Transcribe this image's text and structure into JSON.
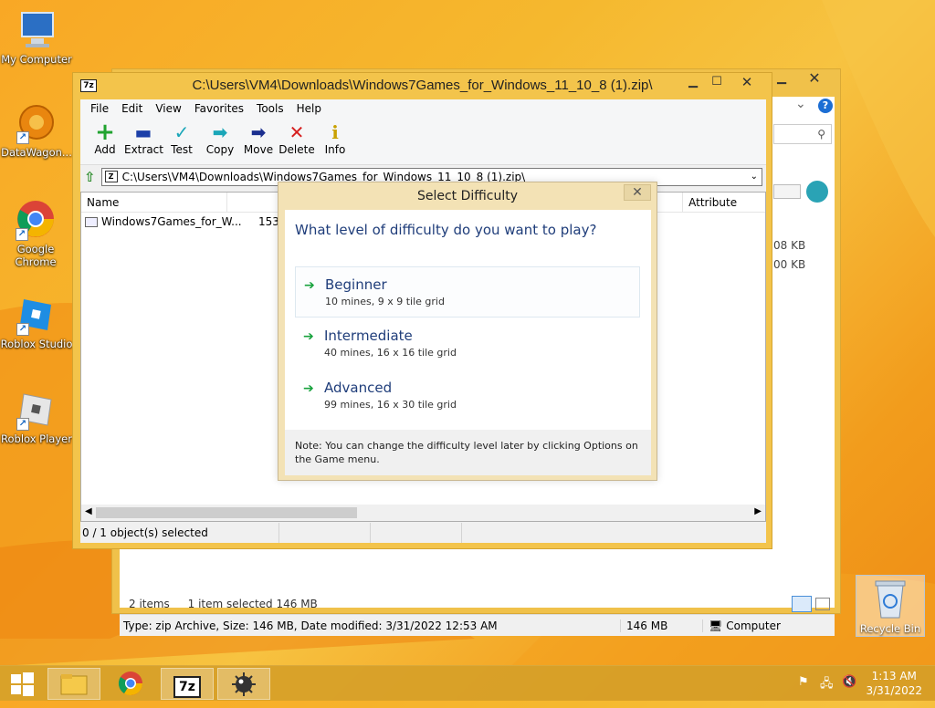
{
  "desktop": {
    "icons": [
      {
        "label": "My Computer"
      },
      {
        "label": "DataWagon..."
      },
      {
        "label": "Google Chrome"
      },
      {
        "label": "Roblox Studio"
      },
      {
        "label": "Roblox Player"
      }
    ],
    "recycle_bin_label": "Recycle Bin"
  },
  "back_window": {
    "size1": "08 KB",
    "size2": "00 KB",
    "items_count": "2 items",
    "selected_info": "1 item selected  146 MB",
    "status_type": "Type: zip Archive, Size: 146 MB, Date modified: 3/31/2022 12:53 AM",
    "status_size": "146 MB",
    "status_location": "Computer"
  },
  "sevenzip": {
    "app_icon_text": "7z",
    "title": "C:\\Users\\VM4\\Downloads\\Windows7Games_for_Windows_11_10_8 (1).zip\\",
    "menu": [
      "File",
      "Edit",
      "View",
      "Favorites",
      "Tools",
      "Help"
    ],
    "toolbar": [
      {
        "label": "Add",
        "icon": "+"
      },
      {
        "label": "Extract",
        "icon": "▬"
      },
      {
        "label": "Test",
        "icon": "✓"
      },
      {
        "label": "Copy",
        "icon": "➡"
      },
      {
        "label": "Move",
        "icon": "➡"
      },
      {
        "label": "Delete",
        "icon": "✕"
      },
      {
        "label": "Info",
        "icon": "i"
      }
    ],
    "address": "C:\\Users\\VM4\\Downloads\\Windows7Games_for_Windows_11_10_8 (1).zip\\",
    "columns": {
      "name": "Name",
      "attributes": "Attribute"
    },
    "rows": [
      {
        "name": "Windows7Games_for_W...",
        "size": "153"
      }
    ],
    "status": "0 / 1 object(s) selected"
  },
  "dialog": {
    "title": "Select Difficulty",
    "question": "What level of difficulty do you want to play?",
    "options": [
      {
        "title": "Beginner",
        "desc": "10 mines, 9 x 9 tile grid"
      },
      {
        "title": "Intermediate",
        "desc": "40 mines, 16 x 16 tile grid"
      },
      {
        "title": "Advanced",
        "desc": "99 mines, 16 x 30 tile grid"
      }
    ],
    "note": "Note: You can change the difficulty level later by clicking Options on the Game menu."
  },
  "taskbar": {
    "time": "1:13 AM",
    "date": "3/31/2022",
    "seven_zip_text": "7z"
  },
  "colors": {
    "accent": "#1f3d7a",
    "arrow": "#18a23d",
    "desktop": "#f5b82e"
  }
}
